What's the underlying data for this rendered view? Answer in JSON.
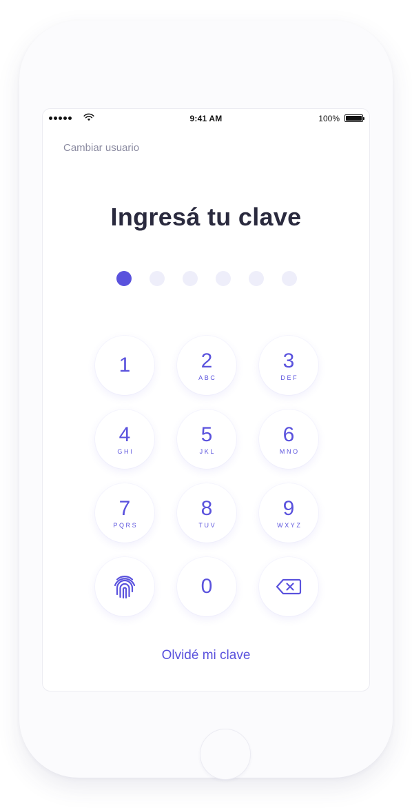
{
  "status_bar": {
    "time": "9:41 AM",
    "battery_percent": "100%",
    "signal_icon": "signal-dots-icon",
    "wifi_icon": "wifi-icon",
    "battery_icon": "battery-icon"
  },
  "header": {
    "change_user_label": "Cambiar usuario"
  },
  "main": {
    "title": "Ingresá tu clave",
    "pin": {
      "length": 6,
      "filled": 1
    }
  },
  "keypad": {
    "keys": [
      {
        "digit": "1",
        "letters": ""
      },
      {
        "digit": "2",
        "letters": "ABC"
      },
      {
        "digit": "3",
        "letters": "DEF"
      },
      {
        "digit": "4",
        "letters": "GHI"
      },
      {
        "digit": "5",
        "letters": "JKL"
      },
      {
        "digit": "6",
        "letters": "MNO"
      },
      {
        "digit": "7",
        "letters": "PQRS"
      },
      {
        "digit": "8",
        "letters": "TUV"
      },
      {
        "digit": "9",
        "letters": "WXYZ"
      },
      {
        "digit": "0",
        "letters": ""
      }
    ],
    "fingerprint_icon": "fingerprint-icon",
    "backspace_icon": "backspace-icon"
  },
  "footer": {
    "forgot_label": "Olvidé mi clave"
  },
  "colors": {
    "accent": "#5a52dd",
    "title": "#2a2a3e",
    "muted": "#8a8aa0",
    "dot_empty": "#eeeefa"
  }
}
